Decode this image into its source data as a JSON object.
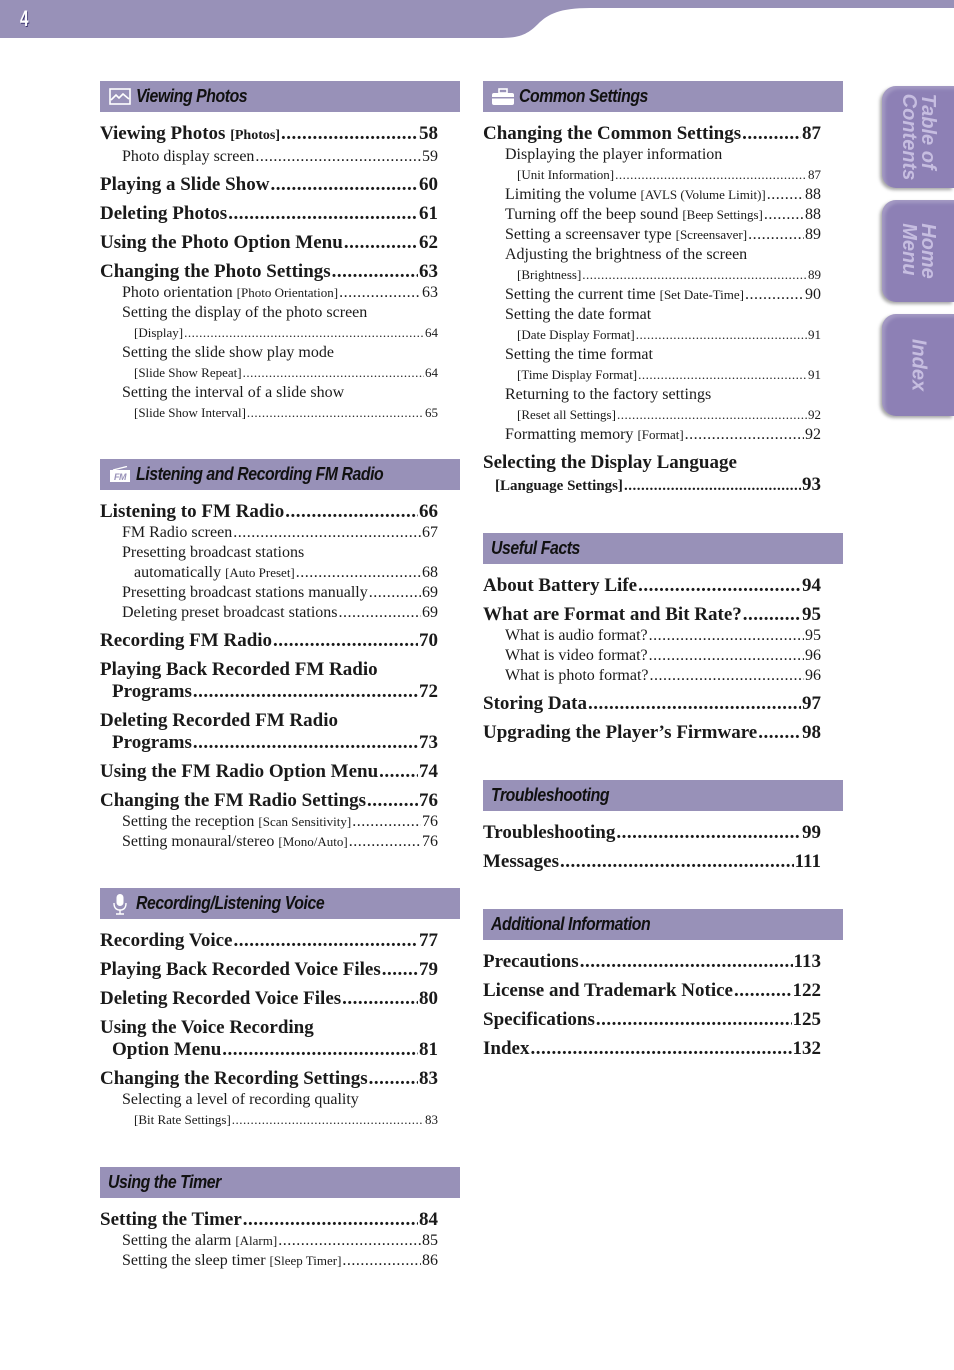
{
  "page_number": "4",
  "nav_tabs": [
    {
      "label": "Table of\nContents"
    },
    {
      "label": "Home\nMenu"
    },
    {
      "label": "Index"
    }
  ],
  "sections": {
    "viewing_photos": {
      "title": "Viewing Photos",
      "icon": "photo-icon",
      "entries": [
        {
          "text": "Viewing Photos",
          "bracket": "[Photos]",
          "page": "58"
        },
        {
          "text": "Photo display screen",
          "page": "59"
        },
        {
          "text": "Playing a Slide Show",
          "page": "60"
        },
        {
          "text": "Deleting Photos",
          "page": "61"
        },
        {
          "text": "Using the Photo Option Menu",
          "page": "62"
        },
        {
          "text": "Changing the Photo Settings",
          "page": "63"
        },
        {
          "text": "Photo orientation",
          "bracket": "[Photo Orientation]",
          "page": "63"
        },
        {
          "text": "Setting the display of the photo screen",
          "bracket": "[Display]",
          "page": "64"
        },
        {
          "text": "Setting the slide show play mode",
          "bracket": "[Slide Show Repeat]",
          "page": "64"
        },
        {
          "text": "Setting the interval of a slide show",
          "bracket": "[Slide Show Interval]",
          "page": "65"
        }
      ]
    },
    "fm_radio": {
      "title": "Listening and Recording FM Radio",
      "icon": "fm-radio-icon",
      "icon_text": "FM",
      "entries": [
        {
          "text": "Listening to FM Radio",
          "page": "66"
        },
        {
          "text": "FM Radio screen",
          "page": "67"
        },
        {
          "text": "Presetting broadcast stations",
          "text2": "automatically",
          "bracket": "[Auto Preset]",
          "page": "68"
        },
        {
          "text": "Presetting broadcast stations manually",
          "page": "69"
        },
        {
          "text": "Deleting preset broadcast stations",
          "page": "69"
        },
        {
          "text": "Recording FM Radio",
          "page": "70"
        },
        {
          "text": "Playing Back Recorded FM Radio",
          "text2": "Programs",
          "page": "72"
        },
        {
          "text": "Deleting Recorded FM Radio",
          "text2": "Programs",
          "page": "73"
        },
        {
          "text": "Using the FM Radio Option Menu",
          "page": "74"
        },
        {
          "text": "Changing the FM Radio Settings",
          "page": "76"
        },
        {
          "text": "Setting the reception",
          "bracket": "[Scan Sensitivity]",
          "page": "76"
        },
        {
          "text": "Setting monaural/stereo",
          "bracket": "[Mono/Auto]",
          "page": "76"
        }
      ]
    },
    "voice": {
      "title": "Recording/Listening Voice",
      "icon": "microphone-icon",
      "entries": [
        {
          "text": "Recording Voice",
          "page": "77"
        },
        {
          "text": "Playing Back Recorded Voice Files",
          "page": "79"
        },
        {
          "text": "Deleting Recorded Voice Files",
          "page": "80"
        },
        {
          "text": "Using the Voice Recording",
          "text2": "Option Menu",
          "page": "81"
        },
        {
          "text": "Changing the Recording Settings",
          "page": "83"
        },
        {
          "text": "Selecting a level of recording quality",
          "bracket": "[Bit Rate Settings]",
          "page": "83"
        }
      ]
    },
    "timer": {
      "title": "Using the Timer",
      "entries": [
        {
          "text": "Setting the Timer",
          "page": "84"
        },
        {
          "text": "Setting the alarm",
          "bracket": "[Alarm]",
          "page": "85"
        },
        {
          "text": "Setting the sleep timer",
          "bracket": "[Sleep Timer]",
          "page": "86"
        }
      ]
    },
    "common_settings": {
      "title": "Common Settings",
      "icon": "toolbox-icon",
      "entries": [
        {
          "text": "Changing the Common Settings",
          "page": "87"
        },
        {
          "text": "Displaying the player information",
          "bracket": "[Unit Information]",
          "page": "87"
        },
        {
          "text": "Limiting the volume",
          "bracket": "[AVLS (Volume Limit)]",
          "page": "88"
        },
        {
          "text": "Turning off the beep sound",
          "bracket": "[Beep Settings]",
          "page": "88"
        },
        {
          "text": "Setting a screensaver type",
          "bracket": "[Screensaver]",
          "page": "89"
        },
        {
          "text": "Adjusting the brightness of the screen",
          "bracket": "[Brightness]",
          "page": "89"
        },
        {
          "text": "Setting the current time",
          "bracket": "[Set Date-Time]",
          "page": "90"
        },
        {
          "text": "Setting the date format",
          "bracket": "[Date Display Format]",
          "page": "91"
        },
        {
          "text": "Setting the time format",
          "bracket": "[Time Display Format]",
          "page": "91"
        },
        {
          "text": "Returning to the factory settings",
          "bracket": "[Reset all Settings]",
          "page": "92"
        },
        {
          "text": "Formatting memory",
          "bracket": "[Format]",
          "page": "92"
        },
        {
          "text": "Selecting the Display Language",
          "bracket": "[Language Settings]",
          "page": "93"
        }
      ]
    },
    "useful_facts": {
      "title": "Useful Facts",
      "entries": [
        {
          "text": "About Battery Life",
          "page": "94"
        },
        {
          "text": "What are Format and Bit Rate?",
          "page": "95"
        },
        {
          "text": "What is audio format?",
          "page": "95"
        },
        {
          "text": "What is video format?",
          "page": "96"
        },
        {
          "text": "What is photo format?",
          "page": "96"
        },
        {
          "text": "Storing Data",
          "page": "97"
        },
        {
          "text": "Upgrading the Player’s Firmware",
          "page": "98"
        }
      ]
    },
    "troubleshooting": {
      "title": "Troubleshooting",
      "entries": [
        {
          "text": "Troubleshooting",
          "page": "99"
        },
        {
          "text": "Messages",
          "page": "111"
        }
      ]
    },
    "additional_info": {
      "title": "Additional Information",
      "entries": [
        {
          "text": "Precautions",
          "page": "113"
        },
        {
          "text": "License and Trademark Notice",
          "page": "122"
        },
        {
          "text": "Specifications",
          "page": "125"
        },
        {
          "text": "Index",
          "page": "132"
        }
      ]
    }
  },
  "colors": {
    "header_band": "#9891b8",
    "section_bar": "#9891b8",
    "nav_tab": "#8d80b5",
    "nav_tab_text": "#c6bde0"
  }
}
